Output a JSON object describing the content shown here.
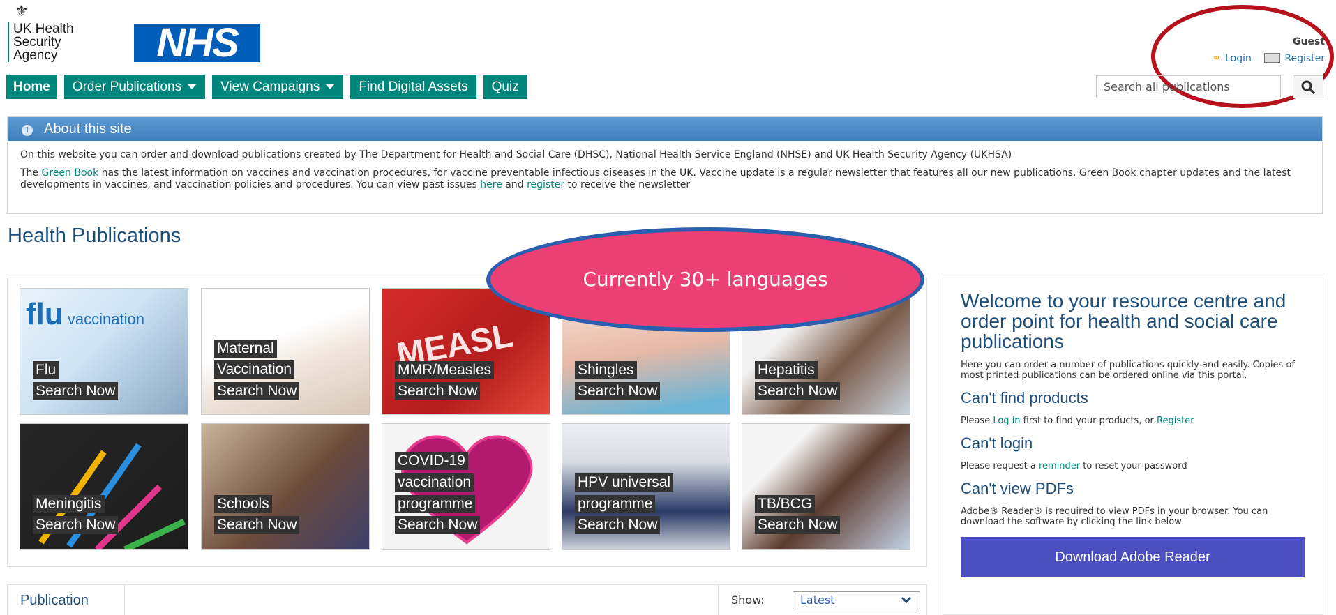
{
  "header": {
    "crest_glyph": "⚜",
    "org_lines": [
      "UK Health",
      "Security",
      "Agency"
    ],
    "nhs_logo": "NHS",
    "user_name": "Guest",
    "login_label": "Login",
    "register_label": "Register"
  },
  "nav": [
    {
      "label": "Home"
    },
    {
      "label": "Order Publications",
      "dropdown": true
    },
    {
      "label": "View Campaigns",
      "dropdown": true
    },
    {
      "label": "Find Digital Assets"
    },
    {
      "label": "Quiz"
    }
  ],
  "search": {
    "placeholder": "Search all publications",
    "button_icon": "search-icon"
  },
  "about": {
    "title": "About this site",
    "p1": "On this website you can order and download publications created by The Department for Health and Social Care (DHSC), National Health Service England (NHSE) and UK Health Security Agency (UKHSA)",
    "p2_pre": "The ",
    "p2_link1": "Green Book",
    "p2_mid": " has the latest information on vaccines and vaccination procedures, for vaccine preventable infectious diseases in the UK. Vaccine update is a regular newsletter that features all our new publications, Green Book chapter updates and the latest developments in vaccines, and vaccination policies and procedures. You can view past issues ",
    "p2_link2": "here",
    "p2_and": " and ",
    "p2_link3": "register",
    "p2_post": " to receive the newsletter"
  },
  "page_title": "Health Publications",
  "callout": "Currently 30+ languages",
  "tiles": [
    {
      "lines": [
        "Flu"
      ],
      "cta": "Search Now"
    },
    {
      "lines": [
        "Maternal",
        "Vaccination"
      ],
      "cta": "Search Now"
    },
    {
      "lines": [
        "MMR/Measles"
      ],
      "cta": "Search Now"
    },
    {
      "lines": [
        "Shingles"
      ],
      "cta": "Search Now"
    },
    {
      "lines": [
        "Hepatitis"
      ],
      "cta": "Search Now"
    },
    {
      "lines": [
        "Meningitis"
      ],
      "cta": "Search Now"
    },
    {
      "lines": [
        "Schools"
      ],
      "cta": "Search Now"
    },
    {
      "lines": [
        "COVID-19",
        "vaccination",
        "programme"
      ],
      "cta": "Search Now"
    },
    {
      "lines": [
        "HPV universal",
        "programme"
      ],
      "cta": "Search Now"
    },
    {
      "lines": [
        "TB/BCG"
      ],
      "cta": "Search Now"
    }
  ],
  "welcome": {
    "title": "Welcome to your resource centre and order point for health and social care publications",
    "intro": "Here you can order a number of publications quickly and easily. Copies of most printed publications can be ordered online via this portal.",
    "h_find": "Can't find products",
    "find_pre": "Please ",
    "find_link1": "Log in",
    "find_mid": " first to find your products, or ",
    "find_link2": "Register",
    "h_login": "Can't login",
    "login_pre": "Please request a ",
    "login_link": "reminder",
    "login_post": " to reset your password",
    "h_pdf": "Can't view PDFs",
    "pdf_text": "Adobe® Reader® is required to view PDFs in your browser. You can download the software by clicking the link below",
    "download_btn": "Download Adobe Reader"
  },
  "publication_bar": {
    "tab": "Publication",
    "show_label": "Show:",
    "show_value": "Latest"
  },
  "colors": {
    "nav": "#00857c",
    "nhs_blue": "#005eb8",
    "callout": "#ec3f73",
    "ring": "#b5121b",
    "download": "#4b4fbf"
  }
}
